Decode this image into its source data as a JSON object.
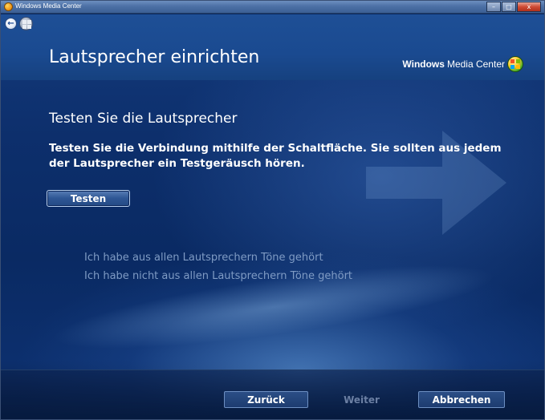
{
  "window": {
    "title": "Windows Media Center",
    "minimize_label": "–",
    "maximize_label": "□",
    "close_label": "x"
  },
  "header": {
    "title": "Lautsprecher einrichten",
    "brand_part1": "Windows",
    "brand_part2": "Media Center"
  },
  "main": {
    "section_title": "Testen Sie die Lautsprecher",
    "instructions": "Testen Sie die Verbindung mithilfe der Schaltfläche. Sie sollten aus jedem der Lautsprecher ein Testgeräusch hören.",
    "test_button": "Testen",
    "options": [
      "Ich habe aus allen Lautsprechern Töne gehört",
      "Ich habe nicht aus allen Lautsprechern Töne gehört"
    ]
  },
  "footer": {
    "back_label": "Zurück",
    "next_label": "Weiter",
    "cancel_label": "Abbrechen"
  },
  "colors": {
    "background": "#0b2a63",
    "header_band": "#1a4a90",
    "option_text": "#7f9bc4",
    "disabled_text": "#6b7fa3"
  },
  "icons": {
    "back": "back-arrow-icon",
    "start": "windows-start-icon",
    "brand": "windows-logo-icon",
    "app": "media-center-icon"
  }
}
